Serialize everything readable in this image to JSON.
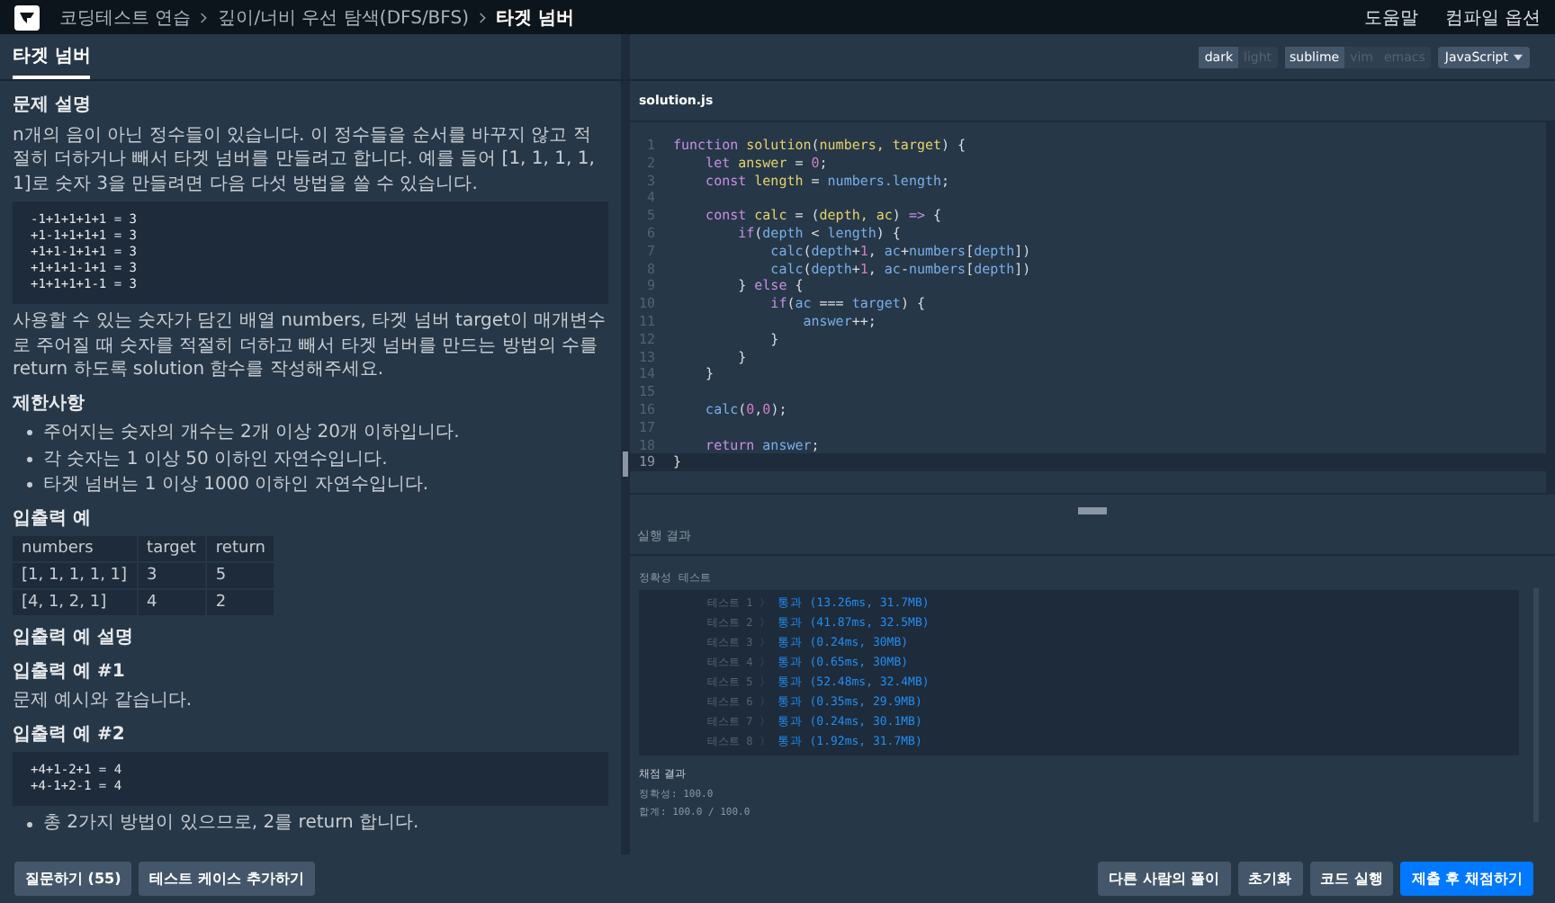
{
  "top_bar": {
    "breadcrumbs": [
      {
        "label": "코딩테스트 연습",
        "current": false
      },
      {
        "label": "깊이/너비 우선 탐색(DFS/BFS)",
        "current": false
      },
      {
        "label": "타겟 넘버",
        "current": true
      }
    ],
    "links": [
      "도움말",
      "컴파일 옵션"
    ]
  },
  "tabs": [
    {
      "label": "타겟 넘버",
      "selected": true
    }
  ],
  "problem": [
    {
      "kind": "heading",
      "text": "문제 설명"
    },
    {
      "kind": "paragraph",
      "text": "n개의 음이 아닌 정수들이 있습니다. 이 정수들을 순서를 바꾸지 않고 적절히 더하거나 빼서 타겟 넘버를 만들려고 합니다. 예를 들어 [1, 1, 1, 1, 1]로 숫자 3을 만들려면 다음 다섯 방법을 쓸 수 있습니다."
    },
    {
      "kind": "code",
      "lines": [
        "-1+1+1+1+1 = 3",
        "+1-1+1+1+1 = 3",
        "+1+1-1+1+1 = 3",
        "+1+1+1-1+1 = 3",
        "+1+1+1+1-1 = 3"
      ]
    },
    {
      "kind": "paragraph",
      "text": "사용할 수 있는 숫자가 담긴 배열 numbers, 타겟 넘버 target이 매개변수로 주어질 때 숫자를 적절히 더하고 빼서 타겟 넘버를 만드는 방법의 수를 return 하도록 solution 함수를 작성해주세요."
    },
    {
      "kind": "heading",
      "text": "제한사항"
    },
    {
      "kind": "bullets",
      "items": [
        "주어지는 숫자의 개수는 2개 이상 20개 이하입니다.",
        "각 숫자는 1 이상 50 이하인 자연수입니다.",
        "타겟 넘버는 1 이상 1000 이하인 자연수입니다."
      ]
    },
    {
      "kind": "heading",
      "text": "입출력 예"
    },
    {
      "kind": "table",
      "columns": [
        "numbers",
        "target",
        "return"
      ],
      "rows": [
        [
          "[1, 1, 1, 1, 1]",
          "3",
          "5"
        ],
        [
          "[4, 1, 2, 1]",
          "4",
          "2"
        ]
      ]
    },
    {
      "kind": "heading",
      "text": "입출력 예 설명"
    },
    {
      "kind": "heading",
      "text": "입출력 예 #1"
    },
    {
      "kind": "paragraph",
      "text": "문제 예시와 같습니다."
    },
    {
      "kind": "heading",
      "text": "입출력 예 #2"
    },
    {
      "kind": "code",
      "lines": [
        "+4+1-2+1 = 4",
        "+4-1+2-1 = 4"
      ]
    },
    {
      "kind": "bullets",
      "items": [
        "총 2가지 방법이 있으므로, 2를 return 합니다."
      ]
    }
  ],
  "editor": {
    "filename": "solution.js",
    "themes": [
      {
        "label": "dark",
        "selected": true
      },
      {
        "label": "light",
        "selected": false
      }
    ],
    "keymaps": [
      {
        "label": "sublime",
        "selected": true
      },
      {
        "label": "vim",
        "selected": false
      },
      {
        "label": "emacs",
        "selected": false
      }
    ],
    "language": "JavaScript",
    "lines": [
      {
        "number": "1",
        "active": false,
        "tokens": [
          {
            "text": "function",
            "kind": "kw"
          },
          {
            "text": " solution",
            "kind": "fn"
          },
          {
            "text": "(",
            "kind": "p"
          },
          {
            "text": "numbers, target",
            "kind": "fn"
          },
          {
            "text": ") {",
            "kind": "p"
          }
        ]
      },
      {
        "number": "2",
        "active": false,
        "tokens": [
          {
            "text": "    let",
            "kind": "kw"
          },
          {
            "text": " answer",
            "kind": "fn"
          },
          {
            "text": " =",
            "kind": "p"
          },
          {
            "text": " 0",
            "kind": "num"
          },
          {
            "text": ";",
            "kind": "p"
          }
        ]
      },
      {
        "number": "3",
        "active": false,
        "tokens": [
          {
            "text": "    const",
            "kind": "kw"
          },
          {
            "text": " length",
            "kind": "fn"
          },
          {
            "text": " =",
            "kind": "p"
          },
          {
            "text": " numbers.length",
            "kind": "var"
          },
          {
            "text": ";",
            "kind": "p"
          }
        ]
      },
      {
        "number": "4",
        "active": false
      },
      {
        "number": "5",
        "active": false,
        "tokens": [
          {
            "text": "    const",
            "kind": "kw"
          },
          {
            "text": " calc",
            "kind": "fn"
          },
          {
            "text": " = (",
            "kind": "p"
          },
          {
            "text": "depth, ac",
            "kind": "fn"
          },
          {
            "text": ")",
            "kind": "p"
          },
          {
            "text": " =>",
            "kind": "kw"
          },
          {
            "text": " {",
            "kind": "p"
          }
        ]
      },
      {
        "number": "6",
        "active": false,
        "tokens": [
          {
            "text": "        if",
            "kind": "kw"
          },
          {
            "text": "(",
            "kind": "p"
          },
          {
            "text": "depth",
            "kind": "var"
          },
          {
            "text": " <",
            "kind": "p"
          },
          {
            "text": " length",
            "kind": "var"
          },
          {
            "text": ") {",
            "kind": "p"
          }
        ]
      },
      {
        "number": "7",
        "active": false,
        "tokens": [
          {
            "text": "            calc",
            "kind": "var"
          },
          {
            "text": "(",
            "kind": "p"
          },
          {
            "text": "depth",
            "kind": "var"
          },
          {
            "text": "+",
            "kind": "p"
          },
          {
            "text": "1",
            "kind": "num"
          },
          {
            "text": ",",
            "kind": "p"
          },
          {
            "text": " ac",
            "kind": "var"
          },
          {
            "text": "+",
            "kind": "p"
          },
          {
            "text": "numbers",
            "kind": "var"
          },
          {
            "text": "[",
            "kind": "p"
          },
          {
            "text": "depth",
            "kind": "var"
          },
          {
            "text": "])",
            "kind": "p"
          }
        ]
      },
      {
        "number": "8",
        "active": false,
        "tokens": [
          {
            "text": "            calc",
            "kind": "var"
          },
          {
            "text": "(",
            "kind": "p"
          },
          {
            "text": "depth",
            "kind": "var"
          },
          {
            "text": "+",
            "kind": "p"
          },
          {
            "text": "1",
            "kind": "num"
          },
          {
            "text": ",",
            "kind": "p"
          },
          {
            "text": " ac",
            "kind": "var"
          },
          {
            "text": "-",
            "kind": "p"
          },
          {
            "text": "numbers",
            "kind": "var"
          },
          {
            "text": "[",
            "kind": "p"
          },
          {
            "text": "depth",
            "kind": "var"
          },
          {
            "text": "])",
            "kind": "p"
          }
        ]
      },
      {
        "number": "9",
        "active": false,
        "tokens": [
          {
            "text": "        }",
            "kind": "p"
          },
          {
            "text": " else",
            "kind": "kw"
          },
          {
            "text": " {",
            "kind": "p"
          }
        ]
      },
      {
        "number": "10",
        "active": false,
        "tokens": [
          {
            "text": "            if",
            "kind": "kw"
          },
          {
            "text": "(",
            "kind": "p"
          },
          {
            "text": "ac",
            "kind": "var"
          },
          {
            "text": " ===",
            "kind": "p"
          },
          {
            "text": " target",
            "kind": "var"
          },
          {
            "text": ") {",
            "kind": "p"
          }
        ]
      },
      {
        "number": "11",
        "active": false,
        "tokens": [
          {
            "text": "                answer",
            "kind": "var"
          },
          {
            "text": "++;",
            "kind": "p"
          }
        ]
      },
      {
        "number": "12",
        "active": false,
        "tokens": [
          {
            "text": "            }",
            "kind": "p"
          }
        ]
      },
      {
        "number": "13",
        "active": false,
        "tokens": [
          {
            "text": "        }",
            "kind": "p"
          }
        ]
      },
      {
        "number": "14",
        "active": false,
        "tokens": [
          {
            "text": "    }",
            "kind": "p"
          }
        ]
      },
      {
        "number": "15",
        "active": false
      },
      {
        "number": "16",
        "active": false,
        "tokens": [
          {
            "text": "    calc",
            "kind": "var"
          },
          {
            "text": "(",
            "kind": "p"
          },
          {
            "text": "0",
            "kind": "num"
          },
          {
            "text": ",",
            "kind": "p"
          },
          {
            "text": "0",
            "kind": "num"
          },
          {
            "text": ");",
            "kind": "p"
          }
        ]
      },
      {
        "number": "17",
        "active": false
      },
      {
        "number": "18",
        "active": false,
        "tokens": [
          {
            "text": "    return",
            "kind": "kw"
          },
          {
            "text": " answer",
            "kind": "var"
          },
          {
            "text": ";",
            "kind": "p"
          }
        ]
      },
      {
        "number": "19",
        "active": true,
        "tokens": [
          {
            "text": "}",
            "kind": "p"
          }
        ]
      }
    ]
  },
  "results": {
    "title": "실행 결과",
    "group_label": "정확성  테스트",
    "tests": [
      {
        "name": "테스트 1 〉",
        "result": "통과 (13.26ms, 31.7MB)"
      },
      {
        "name": "테스트 2 〉",
        "result": "통과 (41.87ms, 32.5MB)"
      },
      {
        "name": "테스트 3 〉",
        "result": "통과 (0.24ms, 30MB)"
      },
      {
        "name": "테스트 4 〉",
        "result": "통과 (0.65ms, 30MB)"
      },
      {
        "name": "테스트 5 〉",
        "result": "통과 (52.48ms, 32.4MB)"
      },
      {
        "name": "테스트 6 〉",
        "result": "통과 (0.35ms, 29.9MB)"
      },
      {
        "name": "테스트 7 〉",
        "result": "통과 (0.24ms, 30.1MB)"
      },
      {
        "name": "테스트 8 〉",
        "result": "통과 (1.92ms, 31.7MB)"
      }
    ],
    "grading_title": "채점 결과",
    "accuracy": "정확성: 100.0",
    "total": "합계: 100.0 / 100.0"
  },
  "left_buttons": [
    "질문하기 (55)",
    "테스트 케이스 추가하기"
  ],
  "right_buttons": [
    {
      "label": "다른 사람의 풀이",
      "kind": "secondary"
    },
    {
      "label": "초기화",
      "kind": "secondary"
    },
    {
      "label": "코드 실행",
      "kind": "secondary"
    },
    {
      "label": "제출 후 채점하기",
      "kind": "primary"
    }
  ]
}
